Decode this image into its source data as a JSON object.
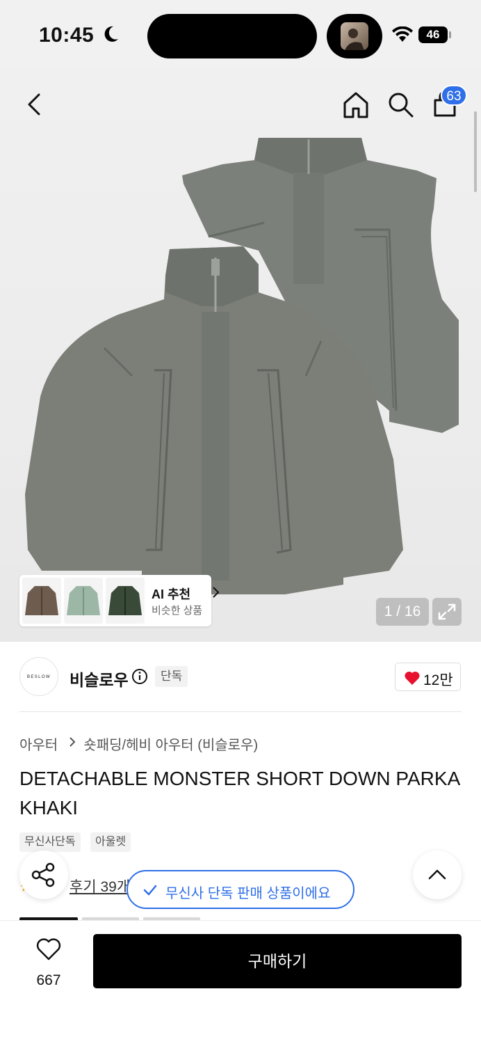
{
  "status_bar": {
    "time": "10:45",
    "battery": "46"
  },
  "nav": {
    "cart_count": "63"
  },
  "gallery": {
    "counter": "1 / 16",
    "ai_recommend": {
      "title": "AI 추천",
      "subtitle": "비슷한 상품",
      "thumb_colors": [
        "#6e5c4e",
        "#9cb7a6",
        "#3a4a38"
      ]
    }
  },
  "brand": {
    "logo_text": "BESLOW",
    "name": "비슬로우",
    "exclusive_tag": "단독",
    "likes": "12만"
  },
  "product": {
    "category": "아우터",
    "subcategory": "숏패딩/헤비 아우터 (비슬로우)",
    "title": "DETACHABLE MONSTER SHORT DOWN PARKA KHAKI",
    "tags": [
      "무신사단독",
      "아울렛"
    ],
    "review_text": "후기 39개"
  },
  "toast": {
    "text": "무신사 단독 판매 상품이에요"
  },
  "bottom_bar": {
    "wish_count": "667",
    "buy_label": "구매하기"
  },
  "colors": {
    "accent": "#2f6fe8",
    "heart": "#e8112d",
    "garment": "#7b7f78"
  }
}
